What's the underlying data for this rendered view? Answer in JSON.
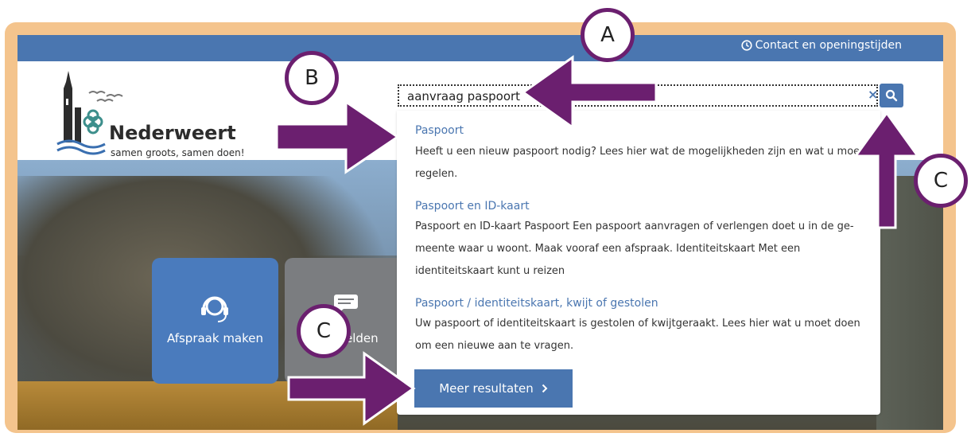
{
  "header": {
    "contact_label": "Contact en openingstijden"
  },
  "logo": {
    "name": "Nederweert",
    "tagline": "samen groots, samen doen!"
  },
  "search": {
    "value": "aanvraag paspoort",
    "clear_symbol": "×"
  },
  "results": [
    {
      "title": "Paspoort",
      "text": "Heeft u een nieuw paspoort nodig? Lees hier wat de mogelijkheden zijn en wat u moet regelen."
    },
    {
      "title": "Paspoort en ID-kaart",
      "text": "Paspoort en ID-kaart Paspoort Een paspoort aanvragen of verlengen doet u in de ge-meente waar u woont. Maak vooraf een afspraak. Identiteitskaart Met een identiteitskaart kunt u reizen"
    },
    {
      "title": "Paspoort / identiteitskaart, kwijt of gestolen",
      "text": "Uw paspoort of identiteitskaart is gestolen of kwijtgeraakt. Lees hier wat u moet doen om een nieuwe aan te vragen."
    }
  ],
  "more_results": "Meer resultaten",
  "tiles": {
    "afspraak": "Afspraak maken",
    "melden_partial": "elden"
  },
  "callouts": {
    "a": "A",
    "b": "B",
    "c1": "C",
    "c2": "C"
  },
  "colors": {
    "brand_blue": "#4a76b0",
    "annotation_purple": "#6b1f6f",
    "frame_orange": "#f4c48d"
  }
}
